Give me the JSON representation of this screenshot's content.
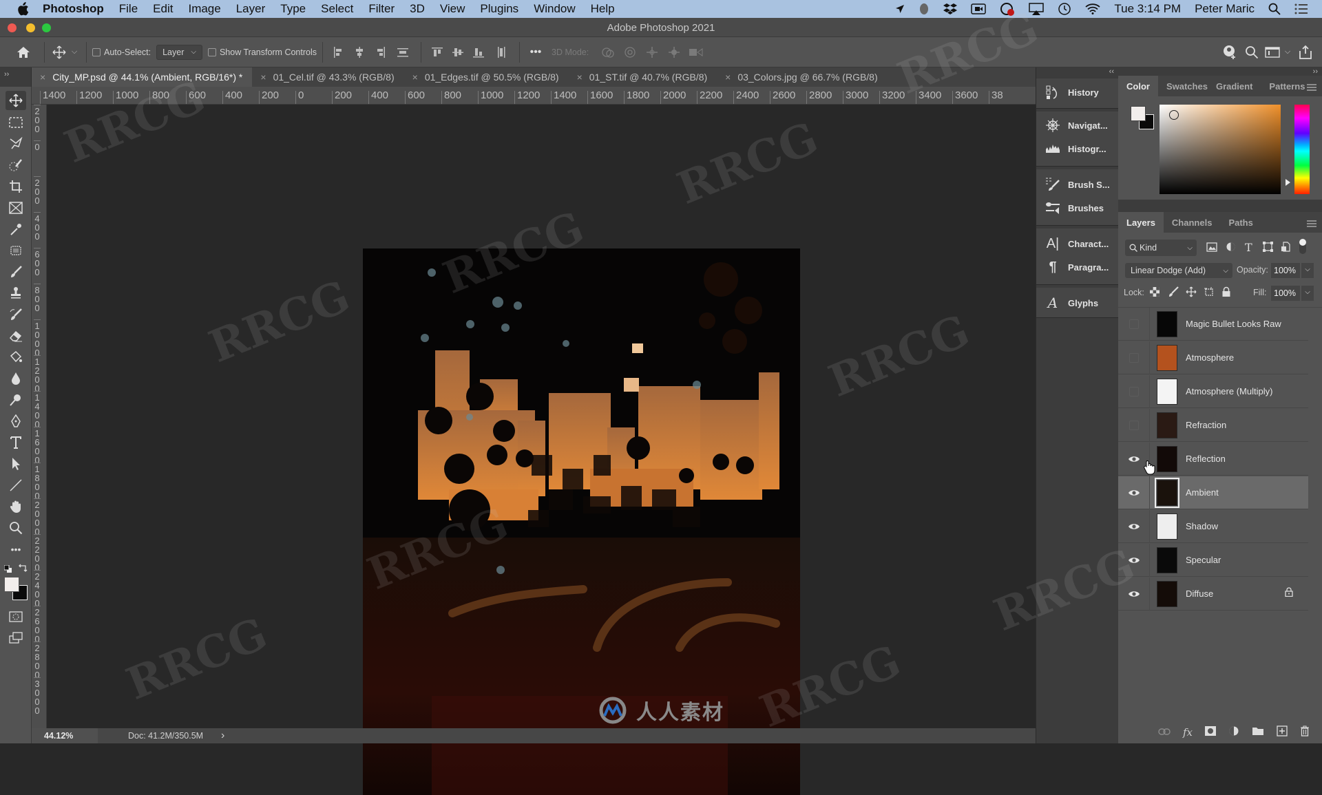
{
  "menubar": {
    "app": "Photoshop",
    "items": [
      "File",
      "Edit",
      "Image",
      "Layer",
      "Type",
      "Select",
      "Filter",
      "3D",
      "View",
      "Plugins",
      "Window",
      "Help"
    ],
    "clock": "Tue 3:14 PM",
    "user": "Peter Maric"
  },
  "window": {
    "title": "Adobe Photoshop 2021"
  },
  "options": {
    "auto_select_label": "Auto-Select:",
    "auto_select_value": "Layer",
    "show_transform_label": "Show Transform Controls",
    "mode3d_label": "3D Mode:"
  },
  "tabs": [
    {
      "label": "City_MP.psd @ 44.1% (Ambient, RGB/16*) *",
      "active": true
    },
    {
      "label": "01_Cel.tif @ 43.3% (RGB/8)"
    },
    {
      "label": "01_Edges.tif @ 50.5% (RGB/8)"
    },
    {
      "label": "01_ST.tif @ 40.7% (RGB/8)"
    },
    {
      "label": "03_Colors.jpg @ 66.7% (RGB/8)"
    }
  ],
  "ruler": {
    "h": [
      "1400",
      "1200",
      "1000",
      "800",
      "600",
      "400",
      "200",
      "0",
      "200",
      "400",
      "600",
      "800",
      "1000",
      "1200",
      "1400",
      "1600",
      "1800",
      "2000",
      "2200",
      "2400",
      "2600",
      "2800",
      "3000",
      "3200",
      "3400",
      "3600",
      "38"
    ],
    "v": [
      "200",
      "0",
      "200",
      "400",
      "600",
      "800",
      "1000",
      "1200",
      "1400",
      "1600",
      "1800",
      "2000",
      "2200",
      "2400",
      "2600",
      "2800",
      "3000"
    ]
  },
  "status": {
    "zoom": "44.12%",
    "doc": "Doc: 41.2M/350.5M",
    "arrow": "›"
  },
  "dock": {
    "items": [
      {
        "label": "History",
        "icon": "history-icon"
      },
      {
        "label": "Navigat...",
        "icon": "navigator-icon"
      },
      {
        "label": "Histogr...",
        "icon": "histogram-icon"
      },
      {
        "label": "Brush S...",
        "icon": "brush-settings-icon"
      },
      {
        "label": "Brushes",
        "icon": "brushes-icon"
      },
      {
        "label": "Charact...",
        "icon": "character-icon"
      },
      {
        "label": "Paragra...",
        "icon": "paragraph-icon"
      },
      {
        "label": "Glyphs",
        "icon": "glyphs-icon"
      }
    ]
  },
  "color_panel": {
    "tabs": [
      "Color",
      "Swatches",
      "Gradient",
      "Patterns"
    ],
    "active_tab": "Color",
    "foreground": "#f2eeec",
    "background": "#0a0a0a",
    "hue_base": "#f0902a"
  },
  "layers_panel": {
    "tabs": [
      "Layers",
      "Channels",
      "Paths"
    ],
    "filter_kind": "Kind",
    "blend_mode": "Linear Dodge (Add)",
    "opacity_label": "Opacity:",
    "opacity": "100%",
    "lock_label": "Lock:",
    "fill_label": "Fill:",
    "fill": "100%",
    "layers": [
      {
        "name": "Magic Bullet Looks Raw",
        "visible": false,
        "thumb": "#070707"
      },
      {
        "name": "Atmosphere",
        "visible": false,
        "thumb": "#b4521e"
      },
      {
        "name": "Atmosphere (Multiply)",
        "visible": false,
        "thumb": "#f4f4f4"
      },
      {
        "name": "Refraction",
        "visible": false,
        "thumb": "#2a1a14"
      },
      {
        "name": "Reflection",
        "visible": true,
        "thumb": "#120a08"
      },
      {
        "name": "Ambient",
        "visible": true,
        "selected": true,
        "thumb": "#1a120c"
      },
      {
        "name": "Shadow",
        "visible": true,
        "thumb": "#eeeeee"
      },
      {
        "name": "Specular",
        "visible": true,
        "thumb": "#0a0a0a"
      },
      {
        "name": "Diffuse",
        "visible": true,
        "locked": true,
        "thumb": "#140c08"
      }
    ]
  },
  "watermark": {
    "text": "RRCG",
    "cn": "人人素材"
  }
}
